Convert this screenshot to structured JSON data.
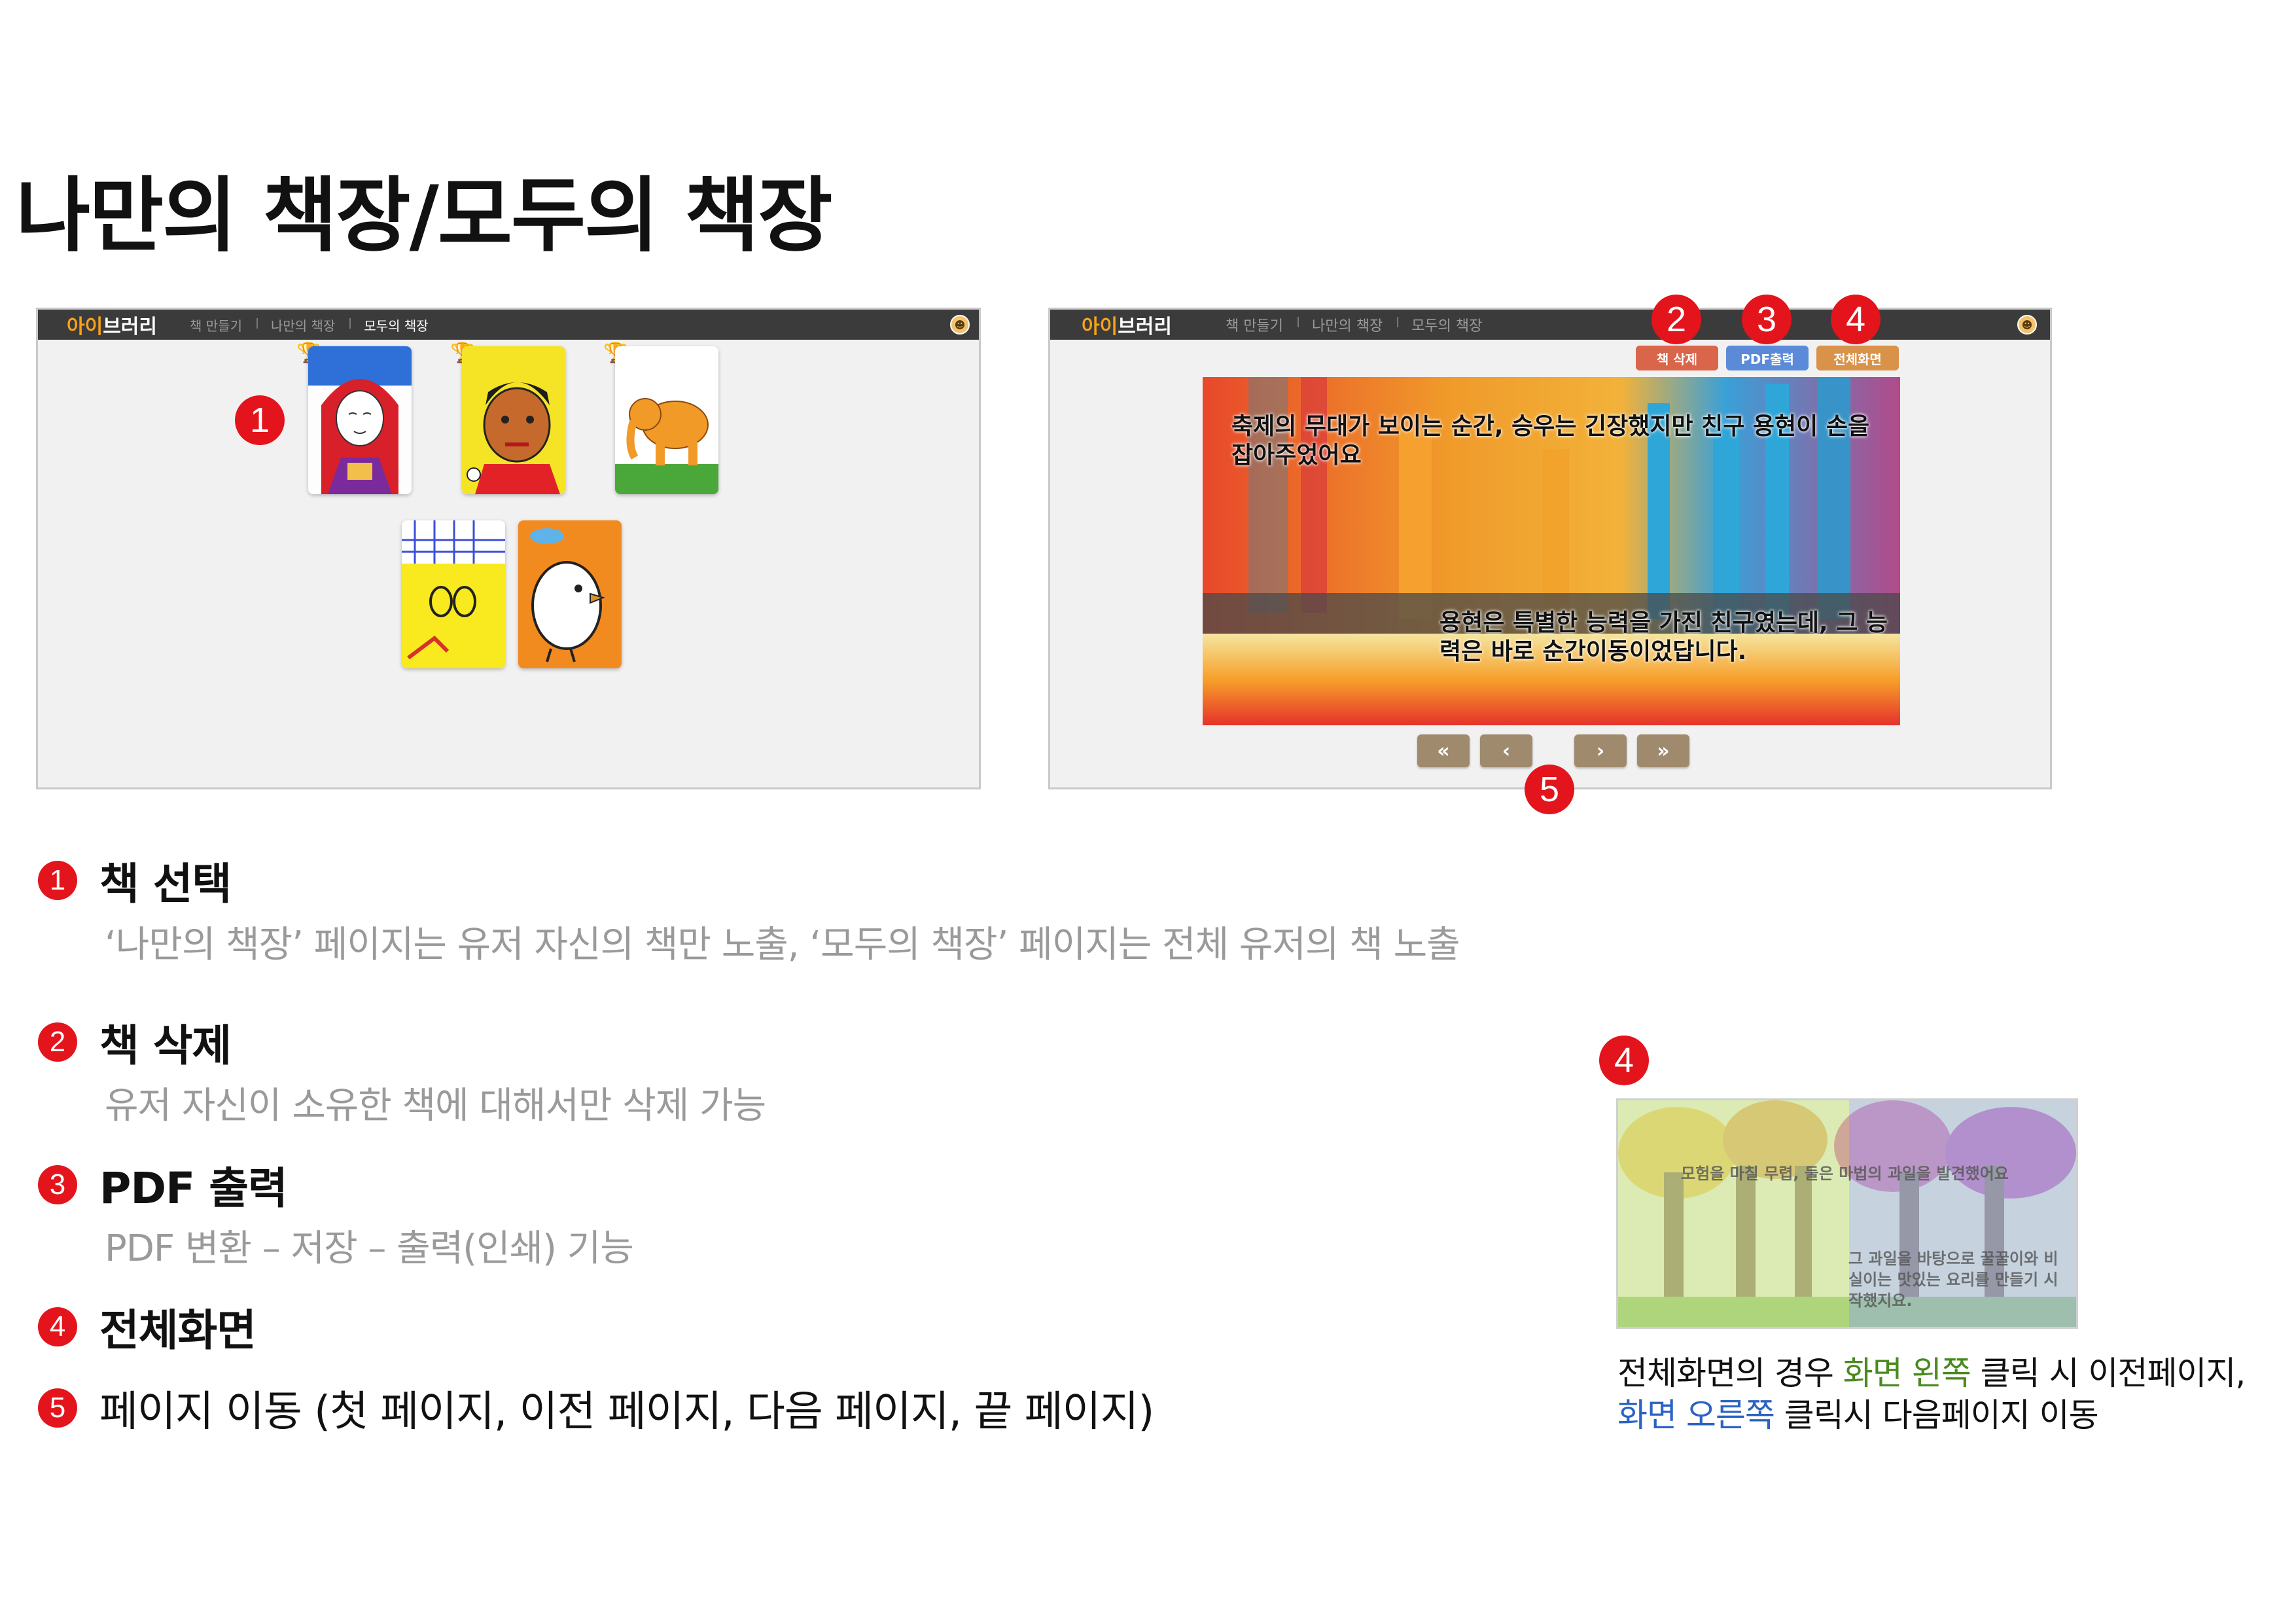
{
  "page_title": "나만의 책장/모두의 책장",
  "app": {
    "brand_prefix": "아이",
    "brand_suffix": "브러리",
    "nav": [
      "책 만들기",
      "나만의 책장",
      "모두의 책장"
    ],
    "avatar_icon": "user-avatar-icon"
  },
  "bookshelf": {
    "active_tab": "모두의 책장",
    "books_count": 5
  },
  "reader": {
    "toolbar": {
      "delete_label": "책 삭제",
      "pdf_label": "PDF출력",
      "fullscreen_label": "전체화면",
      "delete_color": "#d9654a",
      "pdf_color": "#5b8ad8",
      "fullscreen_color": "#d9924a"
    },
    "story_top": "축제의 무대가 보이는 순간, 승우는 긴장했지만 친구 용현이 손을 잡아주었어요",
    "story_bottom": "용현은 특별한 능력을 가진 친구였는데, 그 능력은 바로 순간이동이었답니다.",
    "pager": {
      "first": "«",
      "prev": "‹",
      "next": "›",
      "last": "»"
    }
  },
  "markers": [
    "1",
    "2",
    "3",
    "4",
    "5"
  ],
  "features": [
    {
      "num": "1",
      "title": "책 선택",
      "desc": "‘나만의 책장’ 페이지는 유저 자신의 책만 노출, ‘모두의 책장’ 페이지는 전체 유저의 책 노출"
    },
    {
      "num": "2",
      "title": "책 삭제",
      "desc": "유저 자신이 소유한 책에 대해서만 삭제 가능"
    },
    {
      "num": "3",
      "title": "PDF 출력",
      "desc": "PDF 변환 – 저장 – 출력(인쇄) 기능"
    },
    {
      "num": "4",
      "title": "전체화면",
      "desc": ""
    },
    {
      "num": "5",
      "title": "페이지 이동 (첫 페이지, 이전 페이지, 다음 페이지, 끝 페이지)",
      "desc": ""
    }
  ],
  "fullscreen_preview": {
    "marker": "4",
    "text_top": "모험을 마칠 무렵, 둘은 마법의 과일을 발견했어요",
    "text_bottom": "그 과일을 바탕으로 꿀꿀이와 비실이는 맛있는 요리를 만들기 시작했지요.",
    "caption_part1": "전체화면의 경우 ",
    "caption_left": "화면 왼쪽",
    "caption_part2": " 클릭 시 이전페이지,",
    "caption_right": "화면 오른쪽",
    "caption_part3": " 클릭시 다음페이지 이동",
    "left_tint": "#c9e8a6",
    "right_tint": "#a8bff0"
  }
}
